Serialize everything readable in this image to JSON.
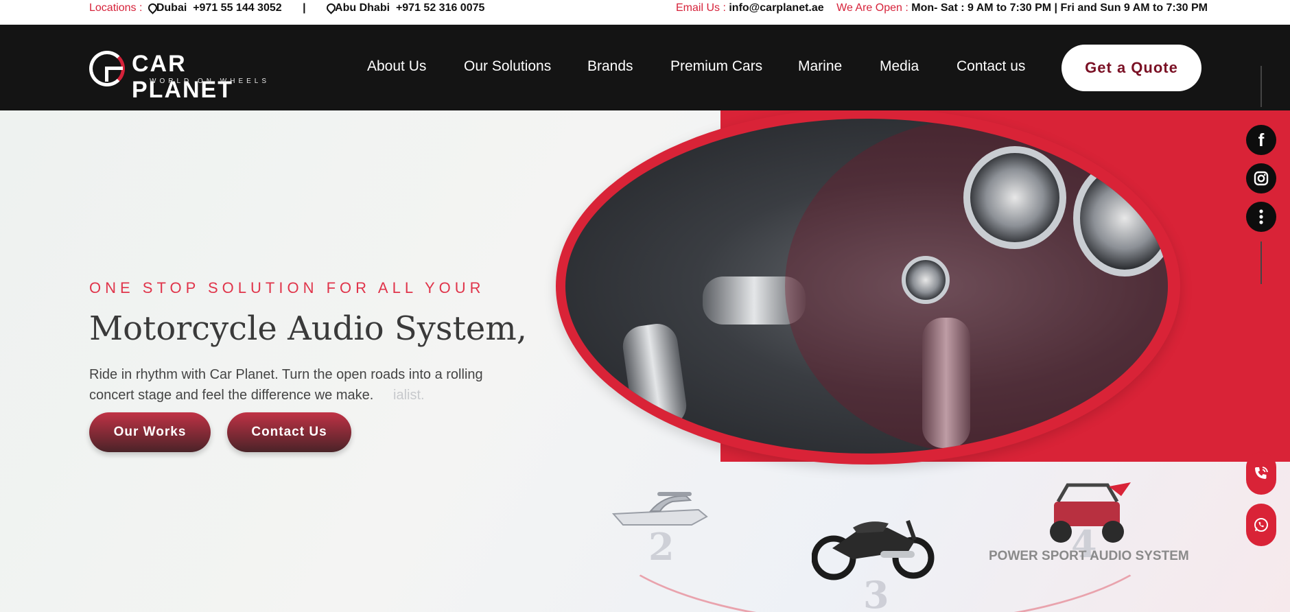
{
  "topbar": {
    "locations_label": "Locations :",
    "dubai_city": "Dubai",
    "dubai_phone": "+971 55 144 3052",
    "separator": "|",
    "abudhabi_city": "Abu Dhabi",
    "abudhabi_phone": "+971 52 316 0075",
    "email_label": "Email Us :",
    "email": "info@carplanet.ae",
    "open_label": "We Are Open :",
    "hours": "Mon- Sat : 9 AM to 7:30 PM | Fri and Sun 9 AM to 7:30 PM"
  },
  "brand": {
    "name": "CAR PLANET",
    "tagline": "WORLD ON WHEELS"
  },
  "nav": {
    "items": [
      "About Us",
      "Our Solutions",
      "Brands",
      "Premium Cars",
      "Marine",
      "Media",
      "Contact us"
    ],
    "cta": "Get a Quote"
  },
  "hero": {
    "eyebrow": "ONE STOP SOLUTION FOR ALL YOUR",
    "headline": "Motorcycle Audio System,",
    "description": "Ride in rhythm with Car Planet. Turn the open roads into a rolling concert stage and feel the difference we make.",
    "ghost_text": "ialist.",
    "btn_works": "Our Works",
    "btn_contact": "Contact Us"
  },
  "carousel": {
    "items": [
      {
        "number": "2",
        "icon": "boat-icon"
      },
      {
        "number": "3",
        "icon": "motorcycle-icon"
      },
      {
        "number": "4",
        "icon": "buggy-icon"
      }
    ],
    "active_label": "POWER SPORT AUDIO SYSTEM"
  },
  "social": {
    "facebook": "f",
    "instagram": "instagram-icon",
    "more": "more-icon"
  },
  "colors": {
    "accent_red": "#d92337",
    "nav_bg": "#141414",
    "quote_text": "#7a1024"
  }
}
